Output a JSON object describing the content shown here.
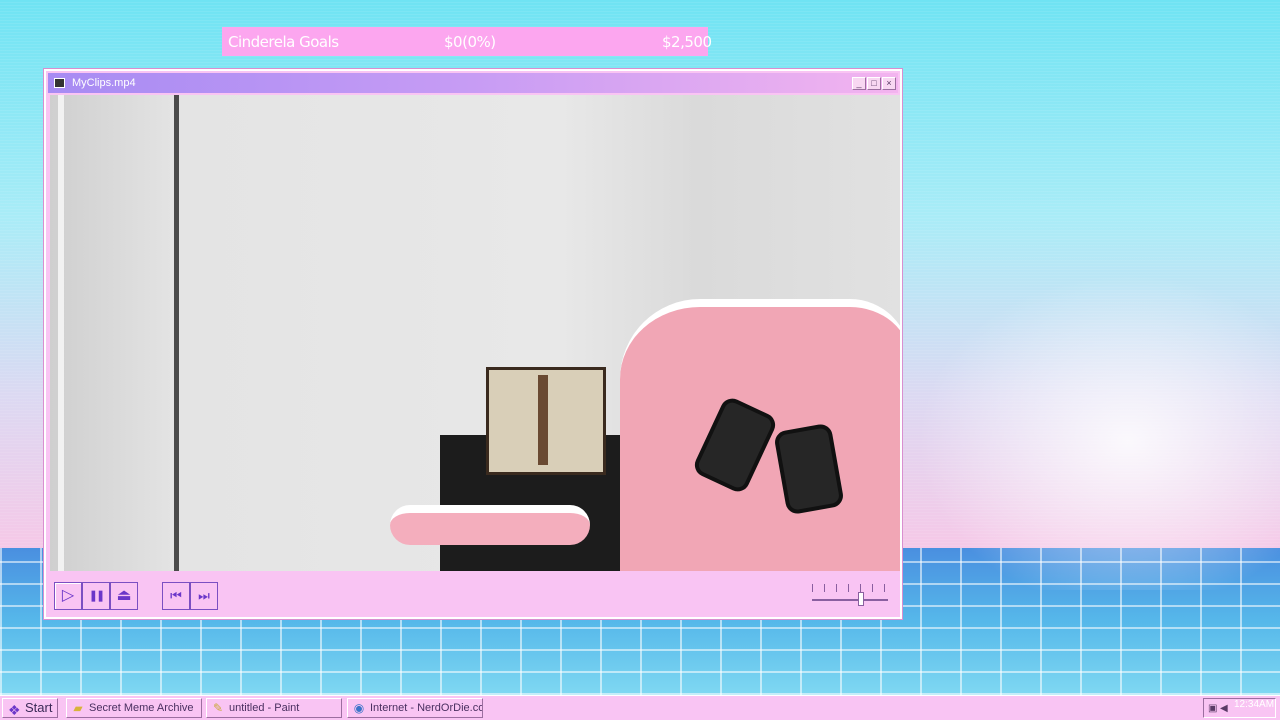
{
  "goal_bar": {
    "title": "Cinderela Goals",
    "progress_text": "$0(0%)",
    "target": "$2,500",
    "progress_fraction": 0
  },
  "window": {
    "title": "MyClips.mp4",
    "icon": "monitor-icon",
    "buttons": {
      "minimize": "_",
      "maximize": "□",
      "close": "×"
    }
  },
  "player": {
    "controls": {
      "play": "▷",
      "pause": "❚❚",
      "eject": "⏏",
      "previous": "⏮",
      "next": "⏭"
    },
    "volume_level": 0.65
  },
  "taskbar": {
    "start_label": "Start",
    "start_icon": "logo-icon",
    "tasks": [
      {
        "label": "Secret Meme Archive",
        "icon": "folder-icon"
      },
      {
        "label": "untitled - Paint",
        "icon": "paint-icon"
      },
      {
        "label": "Internet - NerdOrDie.com",
        "icon": "globe-icon"
      }
    ],
    "clock": "12:34AM"
  },
  "colors": {
    "accent": "#6b37c9",
    "window_bg": "#f9c4f3",
    "goal_bg": "#fca6ef"
  }
}
